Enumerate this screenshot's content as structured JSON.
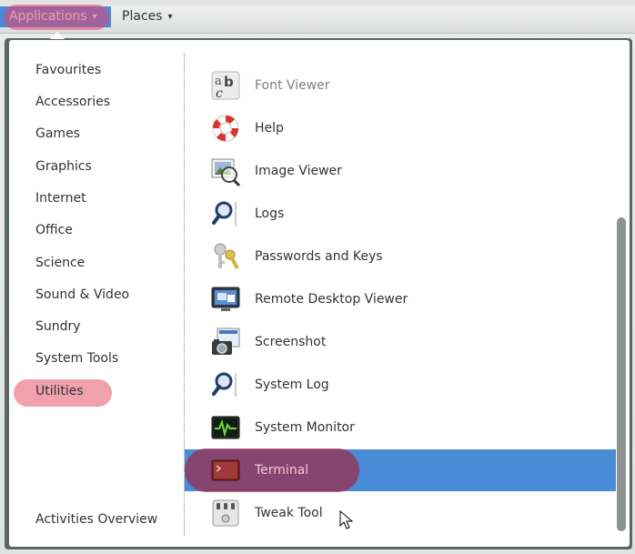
{
  "top_bar": {
    "applications_label": "Applications",
    "places_label": "Places",
    "caret": "▾"
  },
  "categories": [
    {
      "label": "Favourites"
    },
    {
      "label": "Accessories"
    },
    {
      "label": "Games"
    },
    {
      "label": "Graphics"
    },
    {
      "label": "Internet"
    },
    {
      "label": "Office"
    },
    {
      "label": "Science"
    },
    {
      "label": "Sound & Video"
    },
    {
      "label": "Sundry"
    },
    {
      "label": "System Tools"
    },
    {
      "label": "Utilities",
      "highlighted": true
    },
    {
      "label": "Activities Overview"
    }
  ],
  "applications": [
    {
      "label": "Font Viewer",
      "icon": "font-viewer-icon"
    },
    {
      "label": "Help",
      "icon": "lifebuoy-icon"
    },
    {
      "label": "Image Viewer",
      "icon": "image-viewer-icon"
    },
    {
      "label": "Logs",
      "icon": "magnifier-icon"
    },
    {
      "label": "Passwords and Keys",
      "icon": "keys-icon"
    },
    {
      "label": "Remote Desktop Viewer",
      "icon": "remote-desktop-icon"
    },
    {
      "label": "Screenshot",
      "icon": "camera-icon"
    },
    {
      "label": "System Log",
      "icon": "magnifier-icon"
    },
    {
      "label": "System Monitor",
      "icon": "system-monitor-icon"
    },
    {
      "label": "Terminal",
      "icon": "terminal-icon",
      "selected": true
    },
    {
      "label": "Tweak Tool",
      "icon": "tweak-tool-icon"
    }
  ],
  "colors": {
    "selection": "#4a8bd6",
    "highlight_marker": "#e86e80",
    "text": "#2e3436"
  }
}
